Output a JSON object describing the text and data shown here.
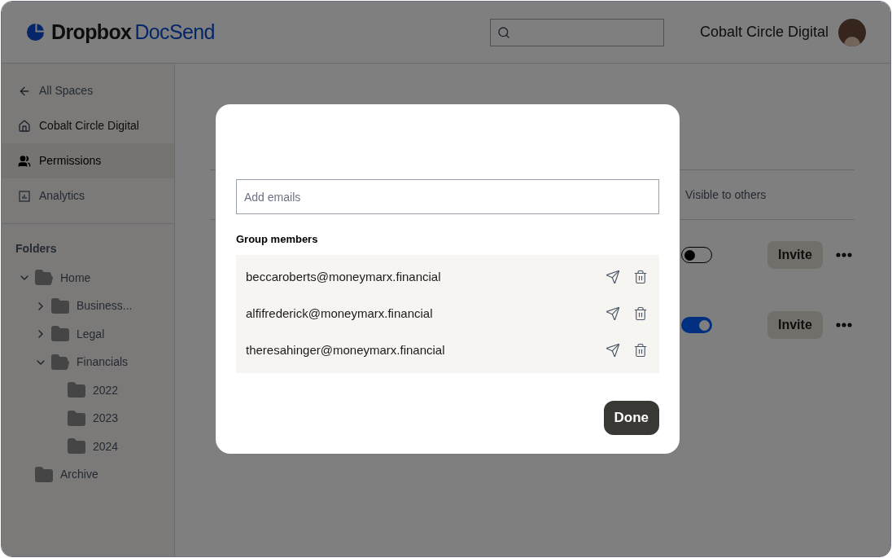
{
  "header": {
    "logo": {
      "brand": "Dropbox",
      "product": "DocSend"
    },
    "account": {
      "name": "Cobalt Circle Digital"
    }
  },
  "sidebar": {
    "nav": [
      {
        "kind": "back",
        "label": "All Spaces",
        "selected": false
      },
      {
        "kind": "home",
        "label": "Cobalt Circle Digital",
        "selected": false
      },
      {
        "kind": "people",
        "label": "Permissions",
        "selected": true
      },
      {
        "kind": "chart",
        "label": "Analytics",
        "selected": false
      }
    ],
    "folders_title": "Folders",
    "folders": [
      {
        "label": "Home",
        "expanded": true,
        "children": [
          {
            "label": "Business...",
            "expanded": false
          },
          {
            "label": "Legal",
            "expanded": false
          },
          {
            "label": "Financials",
            "expanded": true,
            "children": [
              {
                "label": "2022"
              },
              {
                "label": "2023"
              },
              {
                "label": "2024"
              }
            ]
          }
        ]
      },
      {
        "label": "Archive"
      }
    ]
  },
  "main": {
    "columns": [
      "Visible to others"
    ],
    "rows": [
      {
        "visible": false,
        "action": "Invite"
      },
      {
        "visible": true,
        "action": "Invite"
      }
    ]
  },
  "modal": {
    "email_field": {
      "placeholder": "Add emails"
    },
    "section_title": "Group members",
    "members": [
      {
        "email": "beccaroberts@moneymarx.financial"
      },
      {
        "email": "alfifrederick@moneymarx.financial"
      },
      {
        "email": "theresahinger@moneymarx.financial"
      }
    ],
    "done_button": "Done"
  }
}
